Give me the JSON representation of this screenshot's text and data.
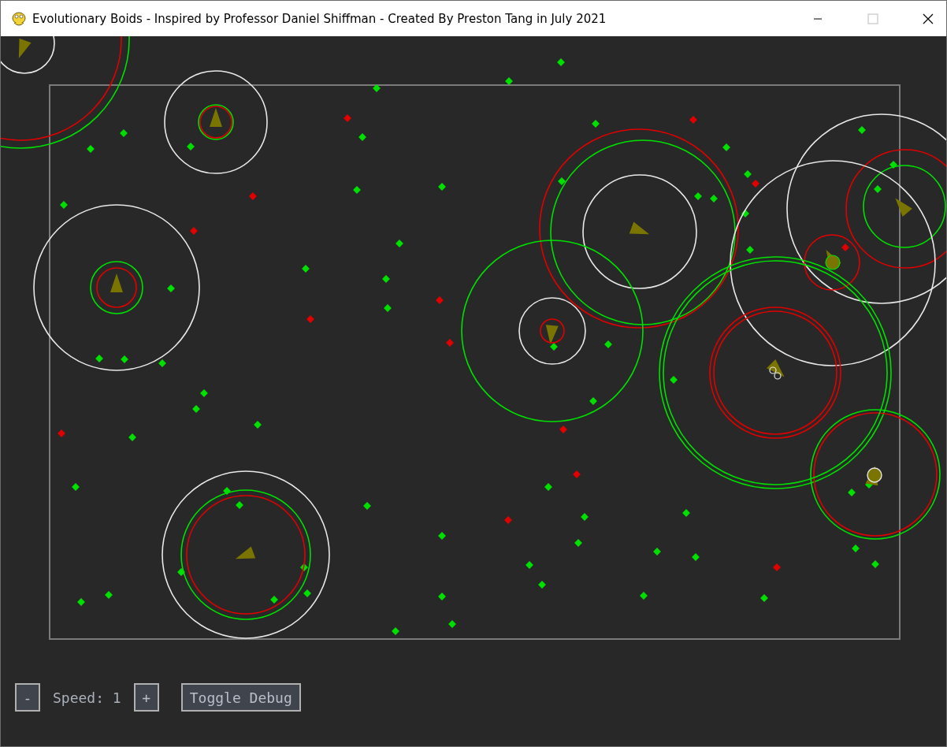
{
  "window": {
    "title": "Evolutionary Boids - Inspired by Professor Daniel Shiffman - Created By Preston Tang in July 2021"
  },
  "controls": {
    "decrease": "-",
    "speed_label": "Speed: 1",
    "increase": "+",
    "toggle": "Toggle Debug"
  }
}
